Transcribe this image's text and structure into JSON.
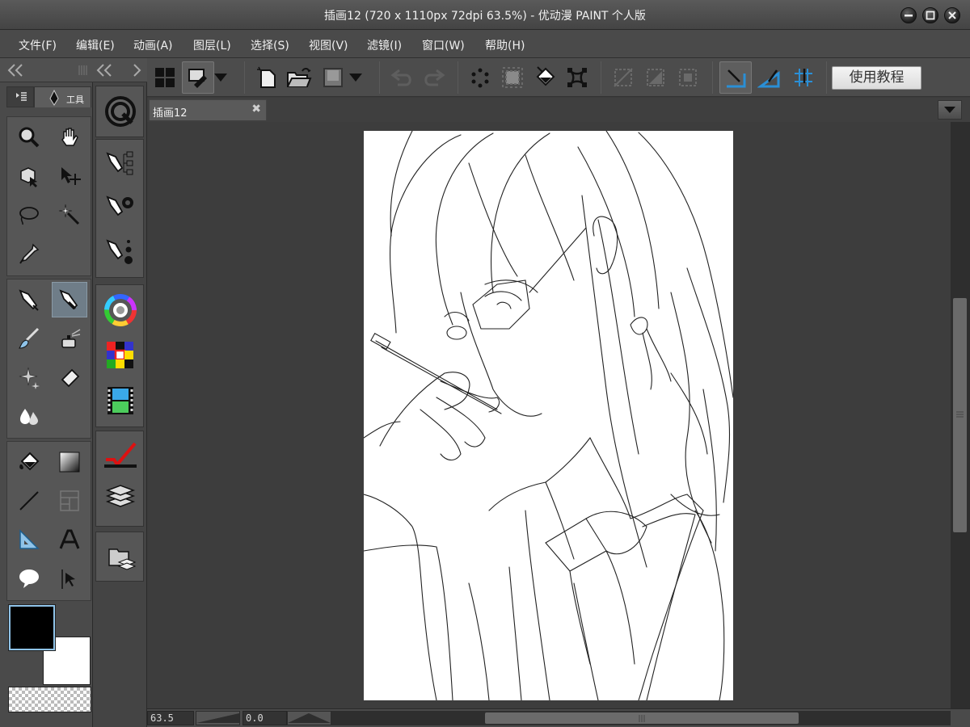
{
  "window": {
    "title": "插画12 (720 x 1110px 72dpi 63.5%)  - 优动漫 PAINT 个人版"
  },
  "menu": {
    "items": [
      {
        "label": "文件(F)"
      },
      {
        "label": "编辑(E)"
      },
      {
        "label": "动画(A)"
      },
      {
        "label": "图层(L)"
      },
      {
        "label": "选择(S)"
      },
      {
        "label": "视图(V)"
      },
      {
        "label": "滤镜(I)"
      },
      {
        "label": "窗口(W)"
      },
      {
        "label": "帮助(H)"
      }
    ]
  },
  "toolbar": {
    "tutorial_label": "使用教程"
  },
  "tool_panel": {
    "tab_label": "工具"
  },
  "document": {
    "tab_label": "插画12",
    "close_symbol": "✖"
  },
  "status": {
    "zoom": "63.5",
    "rotation": "0.0"
  },
  "colors": {
    "main_color": "#000000",
    "sub_color": "#ffffff",
    "active_tool_bg": "#6f7d88",
    "accent_blue": "#2a8fd6"
  },
  "tools": {
    "group1": [
      "zoom-icon",
      "hand-icon",
      "object-icon",
      "move-layer-icon",
      "lasso-icon",
      "magic-wand-icon",
      "eyedropper-icon"
    ],
    "group2": [
      "pen-icon",
      "pencil-icon",
      "brush-icon",
      "airbrush-icon",
      "decoration-icon",
      "eraser-icon",
      "blend-icon"
    ],
    "group3": [
      "fill-icon",
      "gradient-icon",
      "line-icon",
      "frame-icon",
      "ruler-icon",
      "text-icon",
      "balloon-icon",
      "correct-line-icon"
    ]
  }
}
